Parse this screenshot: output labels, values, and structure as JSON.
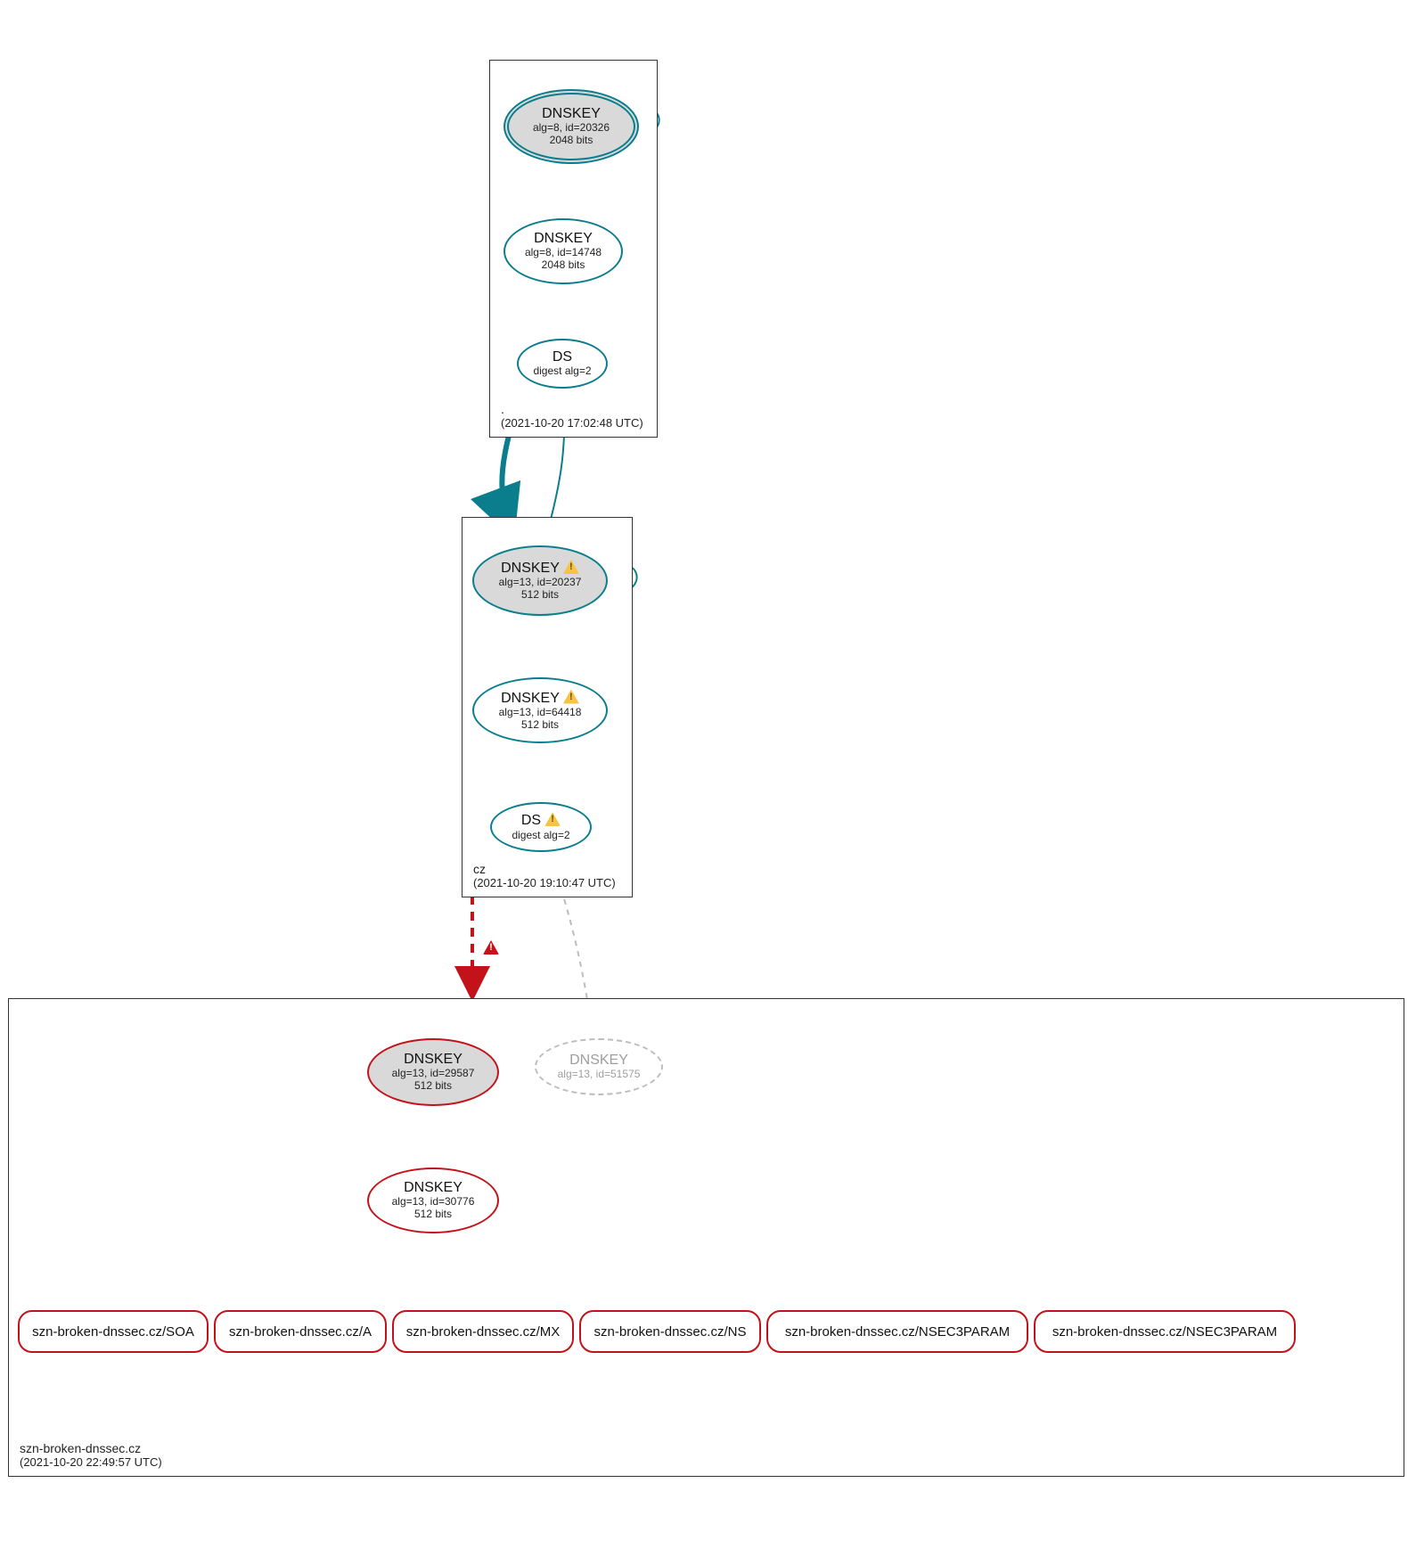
{
  "zones": {
    "root": {
      "name": ".",
      "time": "(2021-10-20 17:02:48 UTC)"
    },
    "cz": {
      "name": "cz",
      "time": "(2021-10-20 19:10:47 UTC)"
    },
    "target": {
      "name": "szn-broken-dnssec.cz",
      "time": "(2021-10-20 22:49:57 UTC)"
    }
  },
  "nodes": {
    "root_ksk": {
      "title": "DNSKEY",
      "sub1": "alg=8, id=20326",
      "sub2": "2048 bits"
    },
    "root_zsk": {
      "title": "DNSKEY",
      "sub1": "alg=8, id=14748",
      "sub2": "2048 bits"
    },
    "root_ds": {
      "title": "DS",
      "sub1": "digest alg=2"
    },
    "cz_ksk": {
      "title": "DNSKEY",
      "sub1": "alg=13, id=20237",
      "sub2": "512 bits"
    },
    "cz_zsk": {
      "title": "DNSKEY",
      "sub1": "alg=13, id=64418",
      "sub2": "512 bits"
    },
    "cz_ds": {
      "title": "DS",
      "sub1": "digest alg=2"
    },
    "t_ksk": {
      "title": "DNSKEY",
      "sub1": "alg=13, id=29587",
      "sub2": "512 bits"
    },
    "t_ghost": {
      "title": "DNSKEY",
      "sub1": "alg=13, id=51575"
    },
    "t_zsk": {
      "title": "DNSKEY",
      "sub1": "alg=13, id=30776",
      "sub2": "512 bits"
    }
  },
  "rrsets": {
    "soa": "szn-broken-dnssec.cz/SOA",
    "a": "szn-broken-dnssec.cz/A",
    "mx": "szn-broken-dnssec.cz/MX",
    "ns": "szn-broken-dnssec.cz/NS",
    "n3p1": "szn-broken-dnssec.cz/NSEC3PARAM",
    "n3p2": "szn-broken-dnssec.cz/NSEC3PARAM"
  },
  "colors": {
    "teal": "#0a7e8c",
    "red": "#c4121a",
    "gray": "#bdbdbd"
  }
}
